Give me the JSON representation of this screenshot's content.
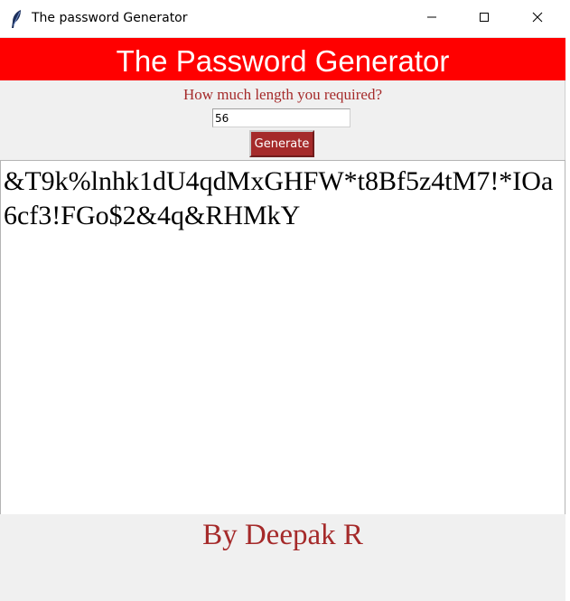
{
  "window": {
    "title": "The password Generator",
    "icon": "feather-icon",
    "controls": [
      "minimize-icon",
      "maximize-icon",
      "close-icon"
    ]
  },
  "header": {
    "title": "The Password Generator",
    "background": "#ff0000",
    "text_color": "#ffffff"
  },
  "form": {
    "prompt": "How much length you required?",
    "length_value": "56",
    "generate_label": "Generate",
    "accent_color": "#a52a2a"
  },
  "output": {
    "password": "&T9k%lnhk1dU4qdMxGHFW*t8Bf5z4tM7!*IOa6cf3!FGo$2&4q&RHMkY"
  },
  "footer": {
    "credit": "By Deepak R"
  }
}
